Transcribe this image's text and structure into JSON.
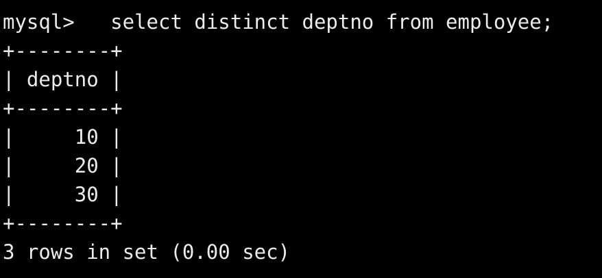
{
  "terminal": {
    "prompt": "mysql>",
    "command": "select distinct deptno from employee;",
    "result": {
      "border": "+--------+",
      "header": "| deptno |",
      "rows": [
        "|     10 |",
        "|     20 |",
        "|     30 |"
      ]
    },
    "summary": "3 rows in set (0.00 sec)"
  },
  "colors": {
    "background": "#000000",
    "text": "#ececec"
  }
}
